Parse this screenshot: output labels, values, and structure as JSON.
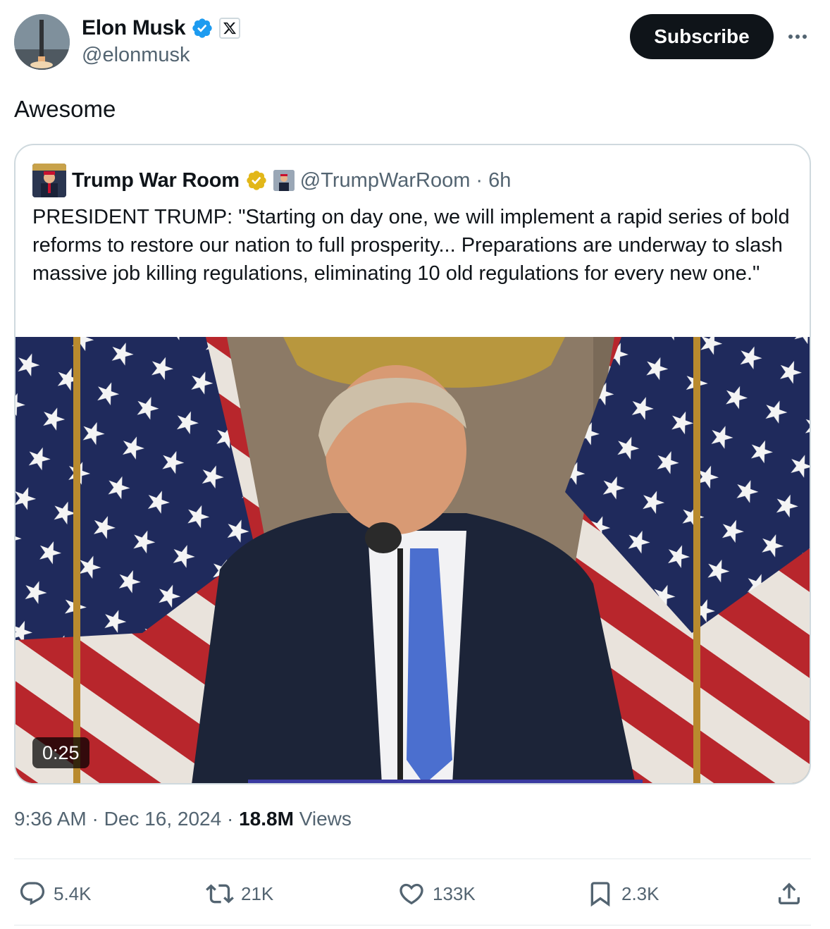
{
  "author": {
    "name": "Elon Musk",
    "handle": "@elonmusk"
  },
  "subscribe_label": "Subscribe",
  "tweet": {
    "text": "Awesome"
  },
  "quoted": {
    "name": "Trump War Room",
    "handle": "@TrumpWarRoom",
    "separator": "·",
    "time": "6h",
    "text": "PRESIDENT TRUMP: \"Starting on day one, we will implement a rapid series of bold reforms to restore our nation to full prosperity... Preparations are underway to slash massive job killing regulations, eliminating 10 old regulations for every new one.\"",
    "video_duration": "0:25"
  },
  "meta": {
    "time": "9:36 AM",
    "sep1": "·",
    "date": "Dec 16, 2024",
    "sep2": "·",
    "views_count": "18.8M",
    "views_label": "Views"
  },
  "actions": {
    "replies": "5.4K",
    "reposts": "21K",
    "likes": "133K",
    "bookmarks": "2.3K"
  },
  "colors": {
    "verified_blue": "#1d9bf0",
    "verified_gold": "#e2b719",
    "text_secondary": "#536471",
    "text_primary": "#0f1419"
  },
  "icons": [
    "verified-badge-icon",
    "x-affiliate-icon",
    "more-icon",
    "gold-verified-icon",
    "reply-icon",
    "repost-icon",
    "like-icon",
    "bookmark-icon",
    "share-icon"
  ]
}
